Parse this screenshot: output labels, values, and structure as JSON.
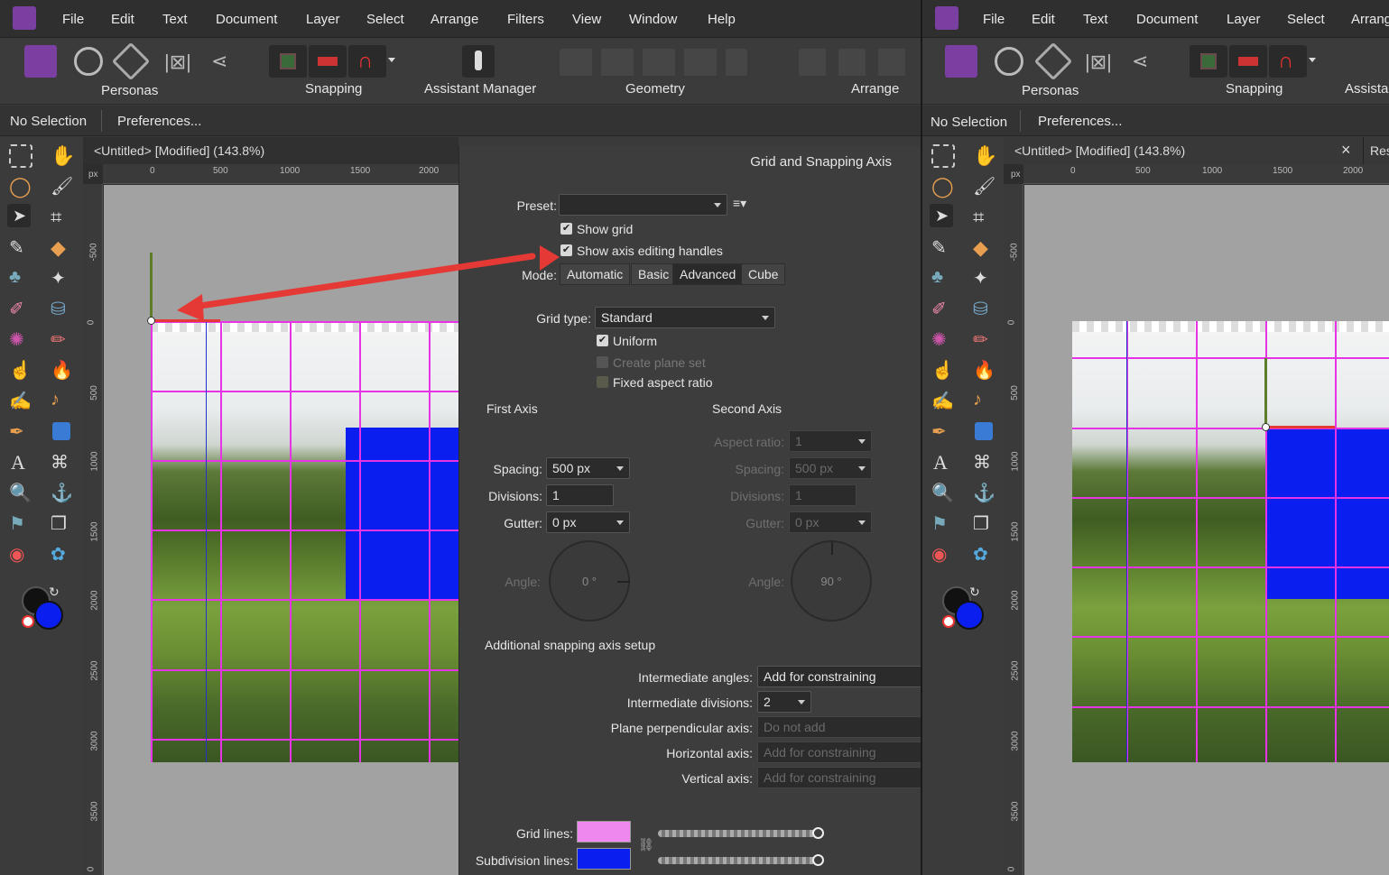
{
  "menu": [
    "File",
    "Edit",
    "Text",
    "Document",
    "Layer",
    "Select",
    "Arrange",
    "Filters",
    "View",
    "Window",
    "Help"
  ],
  "menu_right": [
    "File",
    "Edit",
    "Text",
    "Document",
    "Layer",
    "Select",
    "Arrang"
  ],
  "toolbar": {
    "personas": "Personas",
    "snapping": "Snapping",
    "assistant": "Assistant Manager",
    "geometry": "Geometry",
    "arrange": "Arrange",
    "assistant_right": "Assistar"
  },
  "context": {
    "selection": "No Selection",
    "preferences": "Preferences..."
  },
  "doc": {
    "tab_title": "<Untitled> [Modified] (143.8%)",
    "tab_close": "×",
    "tab_right_partial": "Res",
    "ruler_unit": "px",
    "ruler_h": [
      "0",
      "500",
      "1000",
      "1500",
      "2000"
    ],
    "ruler_v": [
      "-500",
      "0",
      "500",
      "1000",
      "1500",
      "2000",
      "2500",
      "3000",
      "3500",
      "0"
    ]
  },
  "panel": {
    "title": "Grid and Snapping Axis",
    "preset_label": "Preset:",
    "preset_value": "",
    "show_grid": "Show grid",
    "show_axis": "Show axis editing handles",
    "mode_label": "Mode:",
    "modes": [
      "Automatic",
      "Basic",
      "Advanced",
      "Cube"
    ],
    "grid_type_label": "Grid type:",
    "grid_type_value": "Standard",
    "uniform": "Uniform",
    "create_plane": "Create plane set",
    "fixed_aspect": "Fixed aspect ratio",
    "first_axis": "First Axis",
    "second_axis": "Second Axis",
    "aspect_label": "Aspect ratio:",
    "aspect_value": "1",
    "spacing_label": "Spacing:",
    "spacing_value": "500 px",
    "spacing2_value": "500 px",
    "divisions_label": "Divisions:",
    "divisions_value": "1",
    "divisions2_value": "1",
    "gutter_label": "Gutter:",
    "gutter_value": "0 px",
    "gutter2_value": "0 px",
    "angle_label": "Angle:",
    "angle1": "0 °",
    "angle2": "90 °",
    "additional": "Additional snapping axis setup",
    "int_angles_label": "Intermediate angles:",
    "int_angles_value": "Add for constraining",
    "int_div_label": "Intermediate divisions:",
    "int_div_value": "2",
    "plane_perp_label": "Plane perpendicular axis:",
    "plane_perp_value": "Do not add",
    "horiz_label": "Horizontal axis:",
    "horiz_value": "Add for constraining",
    "vert_label": "Vertical axis:",
    "vert_value": "Add for constraining",
    "grid_lines_label": "Grid lines:",
    "subdiv_label": "Subdivision lines:"
  },
  "colors": {
    "grid": "#e633e6",
    "blue": "#0a1ef0",
    "arrow": "#e53935",
    "axis_green": "#5d7d2a"
  }
}
